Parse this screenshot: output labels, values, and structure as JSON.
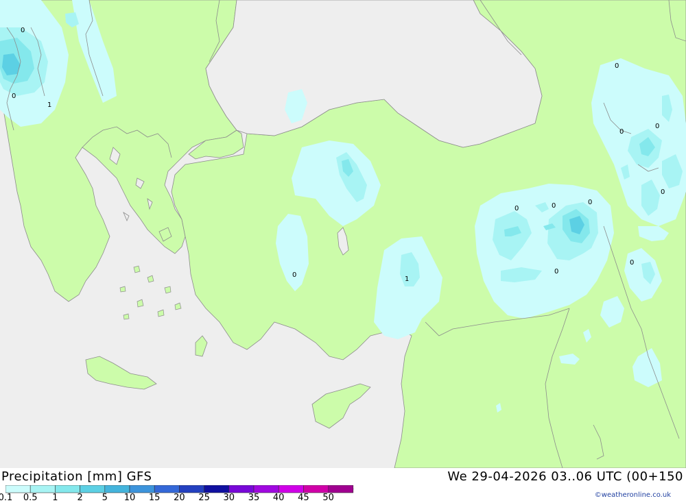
{
  "title": "Precipitation [mm] GFS",
  "datetime": "We 29-04-2026 03..06 UTC (00+150",
  "credit": "©weatheronline.co.uk",
  "legend": {
    "items": [
      {
        "label": "0.1",
        "color": "#ccfcfc"
      },
      {
        "label": "0.5",
        "color": "#a8f4f4"
      },
      {
        "label": "1",
        "color": "#84e8ec"
      },
      {
        "label": "2",
        "color": "#5cd0e4"
      },
      {
        "label": "5",
        "color": "#44b4dc"
      },
      {
        "label": "10",
        "color": "#3c94dc"
      },
      {
        "label": "15",
        "color": "#3468d8"
      },
      {
        "label": "20",
        "color": "#2440c0"
      },
      {
        "label": "25",
        "color": "#1010a0"
      },
      {
        "label": "30",
        "color": "#7808d8"
      },
      {
        "label": "35",
        "color": "#a008e0"
      },
      {
        "label": "40",
        "color": "#d000e8"
      },
      {
        "label": "45",
        "color": "#d000a8"
      },
      {
        "label": "50",
        "color": "#a00090"
      }
    ]
  },
  "colors": {
    "sea": "#eeeeee",
    "land": "#ccfcaa",
    "border": "#8c8c8c"
  },
  "map_labels": [
    "0",
    "0",
    "1",
    "0",
    "0",
    "0",
    "1",
    "0",
    "0",
    "0",
    "0",
    "0",
    "0",
    "0",
    "0"
  ]
}
